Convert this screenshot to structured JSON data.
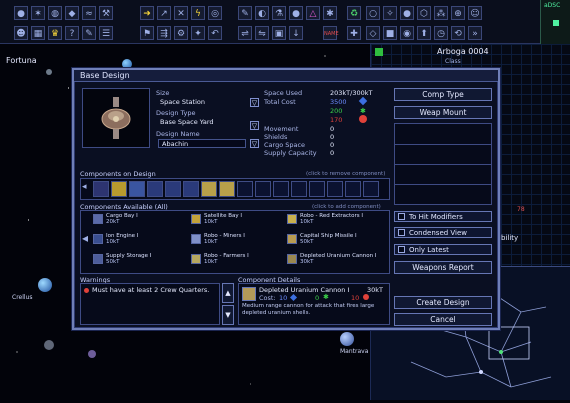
{
  "map": {
    "system_name": "Fortuna",
    "planet_labels": [
      "Crellus",
      "Mantrava"
    ]
  },
  "header": {
    "ship_name": "Arboga 0004",
    "ship_class": "Class",
    "dsc_label": "aDSC"
  },
  "right_panel": {
    "partial_label": "bility",
    "side_value": "78"
  },
  "dialog": {
    "title": "Base Design",
    "size_label": "Size",
    "size_value": "Space Station",
    "design_type_label": "Design Type",
    "design_type_value": "Base Space Yard",
    "design_name_label": "Design Name",
    "design_name_value": "Abachin",
    "stats": [
      {
        "label": "Space Used",
        "value": "203kT/300kT"
      },
      {
        "label": "Total Cost",
        "value": "3500"
      },
      {
        "label": "",
        "value": "200"
      },
      {
        "label": "",
        "value": "170"
      },
      {
        "label": "Movement",
        "value": "0"
      },
      {
        "label": "Shields",
        "value": "0"
      },
      {
        "label": "Cargo Space",
        "value": "0"
      },
      {
        "label": "Supply Capacity",
        "value": "0"
      }
    ],
    "components_on_design_label": "Components on Design",
    "click_remove_hint": "(click to remove component)",
    "components_available_label": "Components Available (All)",
    "click_add_hint": "(click to add component)",
    "available": [
      {
        "name": "Cargo Bay I",
        "size": "20kT"
      },
      {
        "name": "Satellite Bay I",
        "size": "10kT"
      },
      {
        "name": "Robo - Red Extractors I",
        "size": "10kT"
      },
      {
        "name": "Ion Engine I",
        "size": "10kT"
      },
      {
        "name": "Robo - Miners I",
        "size": "10kT"
      },
      {
        "name": "Capital Ship Missile I",
        "size": "50kT"
      },
      {
        "name": "Supply Storage I",
        "size": "50kT"
      },
      {
        "name": "Robo - Farmers I",
        "size": "10kT"
      },
      {
        "name": "Depleted Uranium Cannon I",
        "size": "30kT"
      }
    ],
    "warnings_label": "Warnings",
    "warning_text": "Must have at least 2 Crew Quarters.",
    "component_details_label": "Component Details",
    "detail_name": "Depleted Uranium Cannon I",
    "detail_size": "30kT",
    "detail_cost_label": "Cost:",
    "detail_cost_values": [
      "10",
      "0",
      "10"
    ],
    "detail_description": "Medium range cannon for attack that fires large depleted uranium shells.",
    "buttons": {
      "comp_type": "Comp Type",
      "weap_mount": "Weap Mount",
      "to_hit": "To Hit Modifiers",
      "condensed": "Condensed View",
      "only_latest": "Only Latest",
      "weapons_report": "Weapons Report",
      "create_design": "Create Design",
      "cancel": "Cancel"
    }
  },
  "colors": {
    "accent_border": "#6f7fb8",
    "cost_green": "#3bd24a",
    "cost_red": "#e0423a",
    "cost_blue": "#3c6fe0"
  }
}
